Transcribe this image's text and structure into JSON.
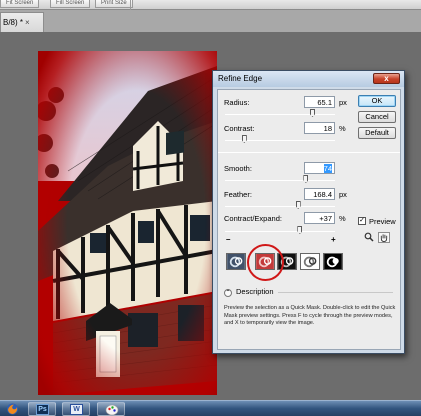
{
  "options_bar": {
    "buttons": [
      "Fit Screen",
      "Fill Screen",
      "Print Size"
    ]
  },
  "document_tab": {
    "label": "B/8) *",
    "close": "×"
  },
  "dialog": {
    "title": "Refine Edge",
    "close_glyph": "x",
    "buttons": {
      "ok": "OK",
      "cancel": "Cancel",
      "default": "Default"
    },
    "preview": {
      "label": "Preview",
      "checked": true,
      "check_glyph": "✓"
    },
    "tools": {
      "zoom": "zoom-icon",
      "hand": "hand-icon"
    },
    "sliders": {
      "radius": {
        "label": "Radius:",
        "value": "65.1",
        "unit": "px",
        "position": 0.8
      },
      "contrast": {
        "label": "Contrast:",
        "value": "18",
        "unit": "%",
        "position": 0.18
      },
      "smooth": {
        "label": "Smooth:",
        "value": "74",
        "unit": "",
        "position": 0.74
      },
      "feather": {
        "label": "Feather:",
        "value": "168.4",
        "unit": "px",
        "position": 0.67
      },
      "contract": {
        "label": "Contract/Expand:",
        "value": "+37",
        "unit": "%",
        "position": 0.685
      }
    },
    "minus": "–",
    "plus": "+",
    "preview_modes": [
      {
        "name": "standard",
        "selected": false
      },
      {
        "name": "quick-mask",
        "selected": true
      },
      {
        "name": "on-black",
        "selected": false
      },
      {
        "name": "on-white",
        "selected": false
      },
      {
        "name": "mask",
        "selected": false
      }
    ],
    "description": {
      "heading": "Description",
      "toggle_glyph": "⌃",
      "text": "Preview the selection as a Quick Mask. Double-click to edit the Quick Mask preview settings. Press F to cycle through the preview modes, and X to temporarily view the image."
    }
  },
  "taskbar": {
    "icons": [
      "firefox-icon",
      "photoshop-icon",
      "word-icon",
      "paint-icon"
    ],
    "photoshop_label": "Ps",
    "word_label": "W"
  },
  "colors": {
    "dialog_title": "#b7cbe1",
    "close_button": "#c7432a",
    "overlay_red": "#b00000",
    "highlight_ring": "#d01818"
  }
}
